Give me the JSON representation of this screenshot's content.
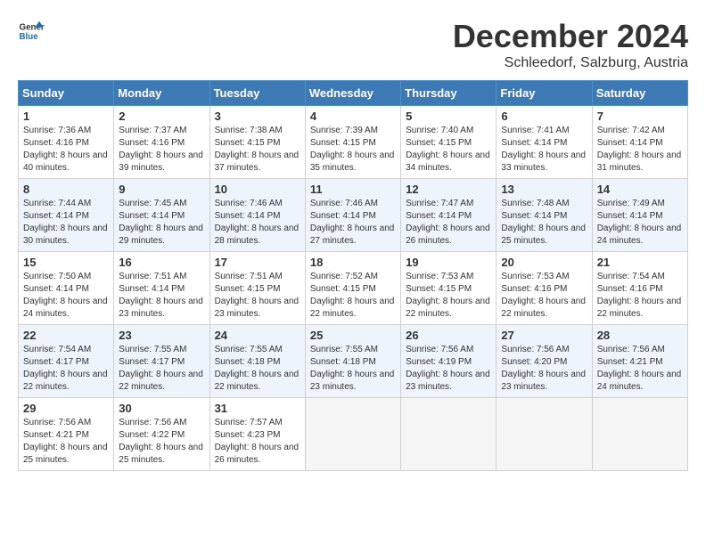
{
  "header": {
    "logo_general": "General",
    "logo_blue": "Blue",
    "title": "December 2024",
    "subtitle": "Schleedorf, Salzburg, Austria"
  },
  "days_of_week": [
    "Sunday",
    "Monday",
    "Tuesday",
    "Wednesday",
    "Thursday",
    "Friday",
    "Saturday"
  ],
  "weeks": [
    [
      {
        "day": "1",
        "sunrise": "Sunrise: 7:36 AM",
        "sunset": "Sunset: 4:16 PM",
        "daylight": "Daylight: 8 hours and 40 minutes."
      },
      {
        "day": "2",
        "sunrise": "Sunrise: 7:37 AM",
        "sunset": "Sunset: 4:16 PM",
        "daylight": "Daylight: 8 hours and 39 minutes."
      },
      {
        "day": "3",
        "sunrise": "Sunrise: 7:38 AM",
        "sunset": "Sunset: 4:15 PM",
        "daylight": "Daylight: 8 hours and 37 minutes."
      },
      {
        "day": "4",
        "sunrise": "Sunrise: 7:39 AM",
        "sunset": "Sunset: 4:15 PM",
        "daylight": "Daylight: 8 hours and 35 minutes."
      },
      {
        "day": "5",
        "sunrise": "Sunrise: 7:40 AM",
        "sunset": "Sunset: 4:15 PM",
        "daylight": "Daylight: 8 hours and 34 minutes."
      },
      {
        "day": "6",
        "sunrise": "Sunrise: 7:41 AM",
        "sunset": "Sunset: 4:14 PM",
        "daylight": "Daylight: 8 hours and 33 minutes."
      },
      {
        "day": "7",
        "sunrise": "Sunrise: 7:42 AM",
        "sunset": "Sunset: 4:14 PM",
        "daylight": "Daylight: 8 hours and 31 minutes."
      }
    ],
    [
      {
        "day": "8",
        "sunrise": "Sunrise: 7:44 AM",
        "sunset": "Sunset: 4:14 PM",
        "daylight": "Daylight: 8 hours and 30 minutes."
      },
      {
        "day": "9",
        "sunrise": "Sunrise: 7:45 AM",
        "sunset": "Sunset: 4:14 PM",
        "daylight": "Daylight: 8 hours and 29 minutes."
      },
      {
        "day": "10",
        "sunrise": "Sunrise: 7:46 AM",
        "sunset": "Sunset: 4:14 PM",
        "daylight": "Daylight: 8 hours and 28 minutes."
      },
      {
        "day": "11",
        "sunrise": "Sunrise: 7:46 AM",
        "sunset": "Sunset: 4:14 PM",
        "daylight": "Daylight: 8 hours and 27 minutes."
      },
      {
        "day": "12",
        "sunrise": "Sunrise: 7:47 AM",
        "sunset": "Sunset: 4:14 PM",
        "daylight": "Daylight: 8 hours and 26 minutes."
      },
      {
        "day": "13",
        "sunrise": "Sunrise: 7:48 AM",
        "sunset": "Sunset: 4:14 PM",
        "daylight": "Daylight: 8 hours and 25 minutes."
      },
      {
        "day": "14",
        "sunrise": "Sunrise: 7:49 AM",
        "sunset": "Sunset: 4:14 PM",
        "daylight": "Daylight: 8 hours and 24 minutes."
      }
    ],
    [
      {
        "day": "15",
        "sunrise": "Sunrise: 7:50 AM",
        "sunset": "Sunset: 4:14 PM",
        "daylight": "Daylight: 8 hours and 24 minutes."
      },
      {
        "day": "16",
        "sunrise": "Sunrise: 7:51 AM",
        "sunset": "Sunset: 4:14 PM",
        "daylight": "Daylight: 8 hours and 23 minutes."
      },
      {
        "day": "17",
        "sunrise": "Sunrise: 7:51 AM",
        "sunset": "Sunset: 4:15 PM",
        "daylight": "Daylight: 8 hours and 23 minutes."
      },
      {
        "day": "18",
        "sunrise": "Sunrise: 7:52 AM",
        "sunset": "Sunset: 4:15 PM",
        "daylight": "Daylight: 8 hours and 22 minutes."
      },
      {
        "day": "19",
        "sunrise": "Sunrise: 7:53 AM",
        "sunset": "Sunset: 4:15 PM",
        "daylight": "Daylight: 8 hours and 22 minutes."
      },
      {
        "day": "20",
        "sunrise": "Sunrise: 7:53 AM",
        "sunset": "Sunset: 4:16 PM",
        "daylight": "Daylight: 8 hours and 22 minutes."
      },
      {
        "day": "21",
        "sunrise": "Sunrise: 7:54 AM",
        "sunset": "Sunset: 4:16 PM",
        "daylight": "Daylight: 8 hours and 22 minutes."
      }
    ],
    [
      {
        "day": "22",
        "sunrise": "Sunrise: 7:54 AM",
        "sunset": "Sunset: 4:17 PM",
        "daylight": "Daylight: 8 hours and 22 minutes."
      },
      {
        "day": "23",
        "sunrise": "Sunrise: 7:55 AM",
        "sunset": "Sunset: 4:17 PM",
        "daylight": "Daylight: 8 hours and 22 minutes."
      },
      {
        "day": "24",
        "sunrise": "Sunrise: 7:55 AM",
        "sunset": "Sunset: 4:18 PM",
        "daylight": "Daylight: 8 hours and 22 minutes."
      },
      {
        "day": "25",
        "sunrise": "Sunrise: 7:55 AM",
        "sunset": "Sunset: 4:18 PM",
        "daylight": "Daylight: 8 hours and 23 minutes."
      },
      {
        "day": "26",
        "sunrise": "Sunrise: 7:56 AM",
        "sunset": "Sunset: 4:19 PM",
        "daylight": "Daylight: 8 hours and 23 minutes."
      },
      {
        "day": "27",
        "sunrise": "Sunrise: 7:56 AM",
        "sunset": "Sunset: 4:20 PM",
        "daylight": "Daylight: 8 hours and 23 minutes."
      },
      {
        "day": "28",
        "sunrise": "Sunrise: 7:56 AM",
        "sunset": "Sunset: 4:21 PM",
        "daylight": "Daylight: 8 hours and 24 minutes."
      }
    ],
    [
      {
        "day": "29",
        "sunrise": "Sunrise: 7:56 AM",
        "sunset": "Sunset: 4:21 PM",
        "daylight": "Daylight: 8 hours and 25 minutes."
      },
      {
        "day": "30",
        "sunrise": "Sunrise: 7:56 AM",
        "sunset": "Sunset: 4:22 PM",
        "daylight": "Daylight: 8 hours and 25 minutes."
      },
      {
        "day": "31",
        "sunrise": "Sunrise: 7:57 AM",
        "sunset": "Sunset: 4:23 PM",
        "daylight": "Daylight: 8 hours and 26 minutes."
      },
      null,
      null,
      null,
      null
    ]
  ]
}
